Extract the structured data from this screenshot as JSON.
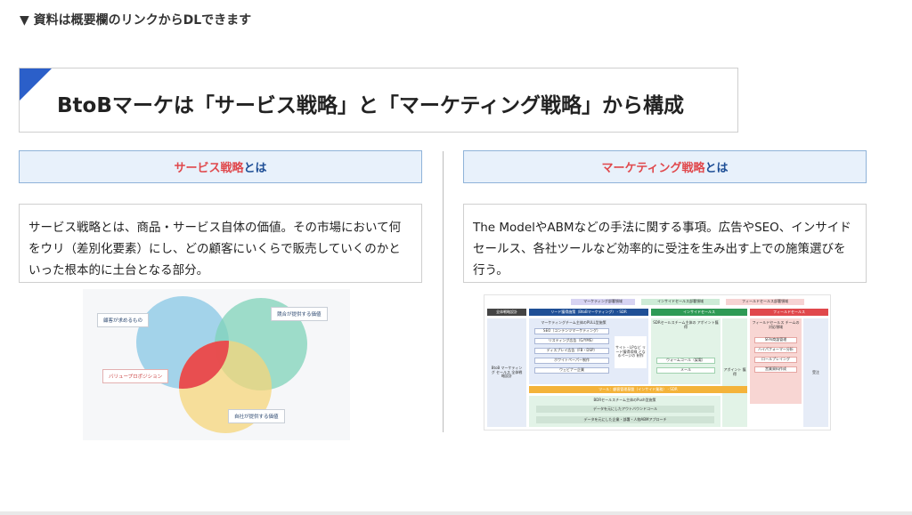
{
  "top_note": "▼ 資料は概要欄のリンクからDLできます",
  "title": "BtoBマーケは「サービス戦略」と「マーケティング戦略」から構成",
  "left": {
    "header_red": "サービス戦略",
    "header_blue": "とは",
    "description": "サービス戦略とは、商品・サービス自体の価値。その市場において何をウリ（差別化要素）にし、どの顧客にいくらで販売していくのかといった根本的に土台となる部分。",
    "venn": {
      "customer": "顧客が求めるもの",
      "competitor": "競合が提供する価値",
      "value_prop": "バリュープロポジション",
      "own": "自社が提供する価値"
    }
  },
  "right": {
    "header_red": "マーケティング戦略",
    "header_blue": "とは",
    "description": "The ModelやABMなどの手法に関する事項。広告やSEO、インサイドセールス、各社ツールなど効率的に受注を生み出す上での施策選びを行う。",
    "diagram": {
      "top_tabs": [
        "マーケティング部署領域",
        "インサイドセールス部署領域",
        "フィールドセールス部署領域"
      ],
      "col_heads": [
        "全体戦略設計",
        "リード獲得施策（BtoBマーケティング） - SDR",
        "インサイドセールス",
        "フィールドセールス"
      ],
      "left_col": "BtoB マーケティング セールス 全体戦略設計",
      "pull_head": "マーケティングチーム主体のPULL型施策",
      "pull_items": [
        "SEO（コンテンツマーケティング）",
        "リスティング広告（G/YMS）",
        "ディスプレイ広告（FB・DSP）",
        "ホワイトペーパー制作",
        "ウェビナー企業"
      ],
      "site_note": "サイト・LPなど リード獲得導線 となるページの 制作",
      "is_head": "SDRセールスチーム主体の アポイント獲得",
      "is_items": [
        "ウォームコール（架電）",
        "メール"
      ],
      "appoint": "アポイント 獲得",
      "fs_head": "フィールドセールス チームの対応領域",
      "fs_items": [
        "SFA/商談管理",
        "ハイパフォーマー分析",
        "ロールプレイング",
        "営業資料作成"
      ],
      "order": "受注",
      "tools_bar": "ツール：顧客管理基盤（インサイド業務） - SDR",
      "abm_head": "BDRセールスチーム主体のPush型施策",
      "abm_items": [
        "データを元にしたアウトバウンドコール",
        "データを元にした企業・部署・人物ABMアプローチ"
      ]
    }
  },
  "colors": {
    "accent_blue": "#2b5fc9",
    "header_bg": "#e8f1fb",
    "red": "#e0484c",
    "navy": "#1f4f96"
  }
}
